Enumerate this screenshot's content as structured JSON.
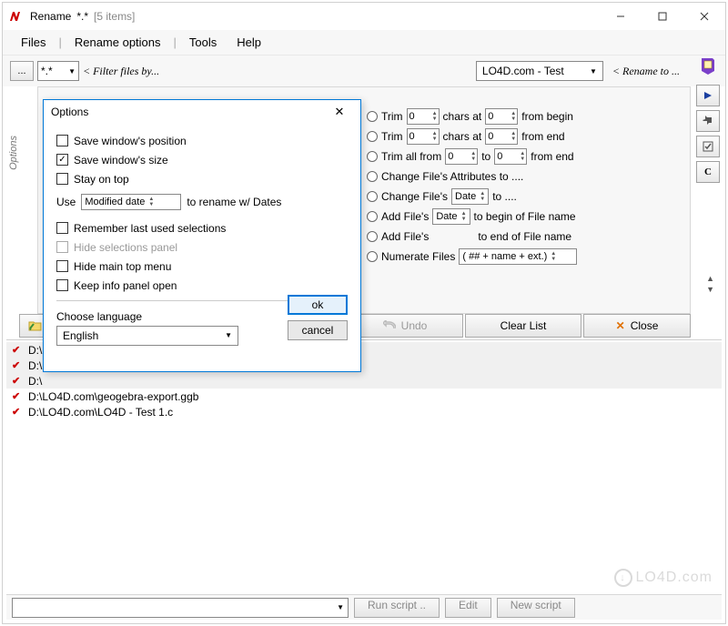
{
  "titlebar": {
    "app_name": "Rename",
    "filter_spec": "*.*",
    "item_count": "[5 items]"
  },
  "menubar": {
    "files": "Files",
    "rename_options": "Rename options",
    "tools": "Tools",
    "help": "Help"
  },
  "toolbar": {
    "dots_btn": "...",
    "filter_value": "*.*",
    "filter_hint": "< Filter files by...",
    "rename_value": "LO4D.com - Test",
    "rename_hint": "< Rename to ..."
  },
  "options_tab": "Options",
  "radio_panel": {
    "trim_begin_1": "Trim",
    "trim_begin_2": "chars at",
    "trim_begin_3": "from begin",
    "trim_end_3": "from  end",
    "trim_all_1": "Trim all from",
    "trim_all_2": "to",
    "trim_all_3": "from end",
    "change_attr": "Change File's Attributes to ....",
    "change_date_1": "Change File's",
    "change_date_2": "to ....",
    "add_begin_1": "Add File's",
    "add_begin_2": "to begin of File name",
    "add_end_2": "to end of File name",
    "numerate_1": "Numerate Files",
    "date_opt": "Date",
    "numerate_pattern": "( ## + name + ext.)",
    "spin0": "0"
  },
  "actions": {
    "undo": "Undo",
    "clear_list": "Clear List",
    "close": "Close"
  },
  "files": [
    {
      "path": "D:\\",
      "truncated": true
    },
    {
      "path": "D:\\",
      "truncated": true
    },
    {
      "path": "D:\\",
      "truncated": true
    },
    {
      "path": "D:\\LO4D.com\\geogebra-export.ggb",
      "truncated": false
    },
    {
      "path": "D:\\LO4D.com\\LO4D - Test 1.c",
      "truncated": false
    }
  ],
  "statusbar": {
    "run_script": "Run script ..",
    "edit": "Edit",
    "new_script": "New script"
  },
  "dialog": {
    "title": "Options",
    "save_pos": "Save window's position",
    "save_size": "Save window's size",
    "stay_top": "Stay on top",
    "use_label": "Use",
    "date_mode": "Modified date",
    "use_suffix": "to rename w/ Dates",
    "remember": "Remember last used selections",
    "hide_sel": "Hide selections panel",
    "hide_menu": "Hide main top menu",
    "keep_info": "Keep info panel open",
    "choose_lang": "Choose language",
    "lang": "English",
    "ok": "ok",
    "cancel": "cancel"
  },
  "watermark": "LO4D.com"
}
